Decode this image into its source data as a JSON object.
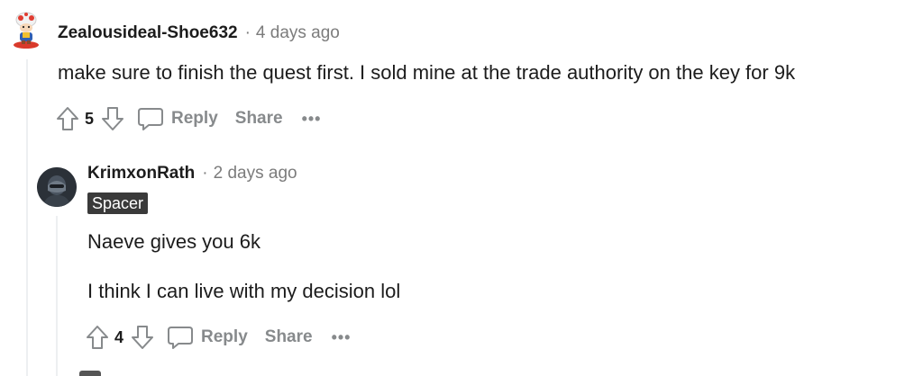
{
  "comments": [
    {
      "username": "Zealousideal-Shoe632",
      "separator": "·",
      "timestamp": "4 days ago",
      "avatar_icon": "snoo-toad-avatar",
      "body": [
        "make sure to finish the quest first. I sold mine at the trade authority on the key for 9k"
      ],
      "upvote_icon": "upvote-arrow-icon",
      "vote_count": "5",
      "downvote_icon": "downvote-arrow-icon",
      "reply_icon": "speech-bubble-icon",
      "reply_label": "Reply",
      "share_label": "Share",
      "more_label": "•••"
    },
    {
      "username": "KrimxonRath",
      "separator": "·",
      "timestamp": "2 days ago",
      "avatar_icon": "dark-helmet-avatar",
      "flair": "Spacer",
      "body": [
        "Naeve gives you 6k",
        "I think I can live with my decision lol"
      ],
      "upvote_icon": "upvote-arrow-icon",
      "vote_count": "4",
      "downvote_icon": "downvote-arrow-icon",
      "reply_icon": "speech-bubble-icon",
      "reply_label": "Reply",
      "share_label": "Share",
      "more_label": "•••"
    }
  ],
  "colors": {
    "text": "#1c1c1c",
    "muted": "#7c7c7c",
    "action": "#878a8c",
    "thread_line": "#edeff1",
    "flair_bg": "#3a3a3a"
  }
}
